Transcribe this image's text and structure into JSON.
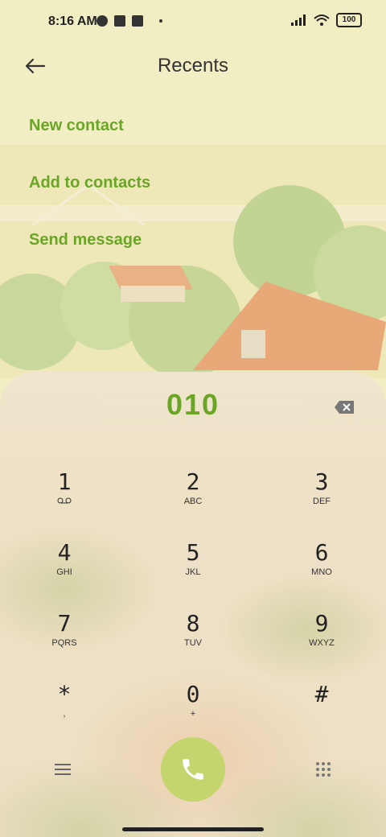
{
  "status": {
    "time": "8:16 AM",
    "battery": "100"
  },
  "header": {
    "title": "Recents"
  },
  "menu": [
    {
      "label": "New contact"
    },
    {
      "label": "Add to contacts"
    },
    {
      "label": "Send message"
    }
  ],
  "dialer": {
    "number": "010",
    "keys": [
      {
        "digit": "1",
        "sub": ""
      },
      {
        "digit": "2",
        "sub": "ABC"
      },
      {
        "digit": "3",
        "sub": "DEF"
      },
      {
        "digit": "4",
        "sub": "GHI"
      },
      {
        "digit": "5",
        "sub": "JKL"
      },
      {
        "digit": "6",
        "sub": "MNO"
      },
      {
        "digit": "7",
        "sub": "PQRS"
      },
      {
        "digit": "8",
        "sub": "TUV"
      },
      {
        "digit": "9",
        "sub": "WXYZ"
      },
      {
        "digit": "*",
        "sub": ","
      },
      {
        "digit": "0",
        "sub": "+"
      },
      {
        "digit": "#",
        "sub": ""
      }
    ]
  },
  "colors": {
    "accent": "#6aa526",
    "call_button": "#c3d56c"
  }
}
